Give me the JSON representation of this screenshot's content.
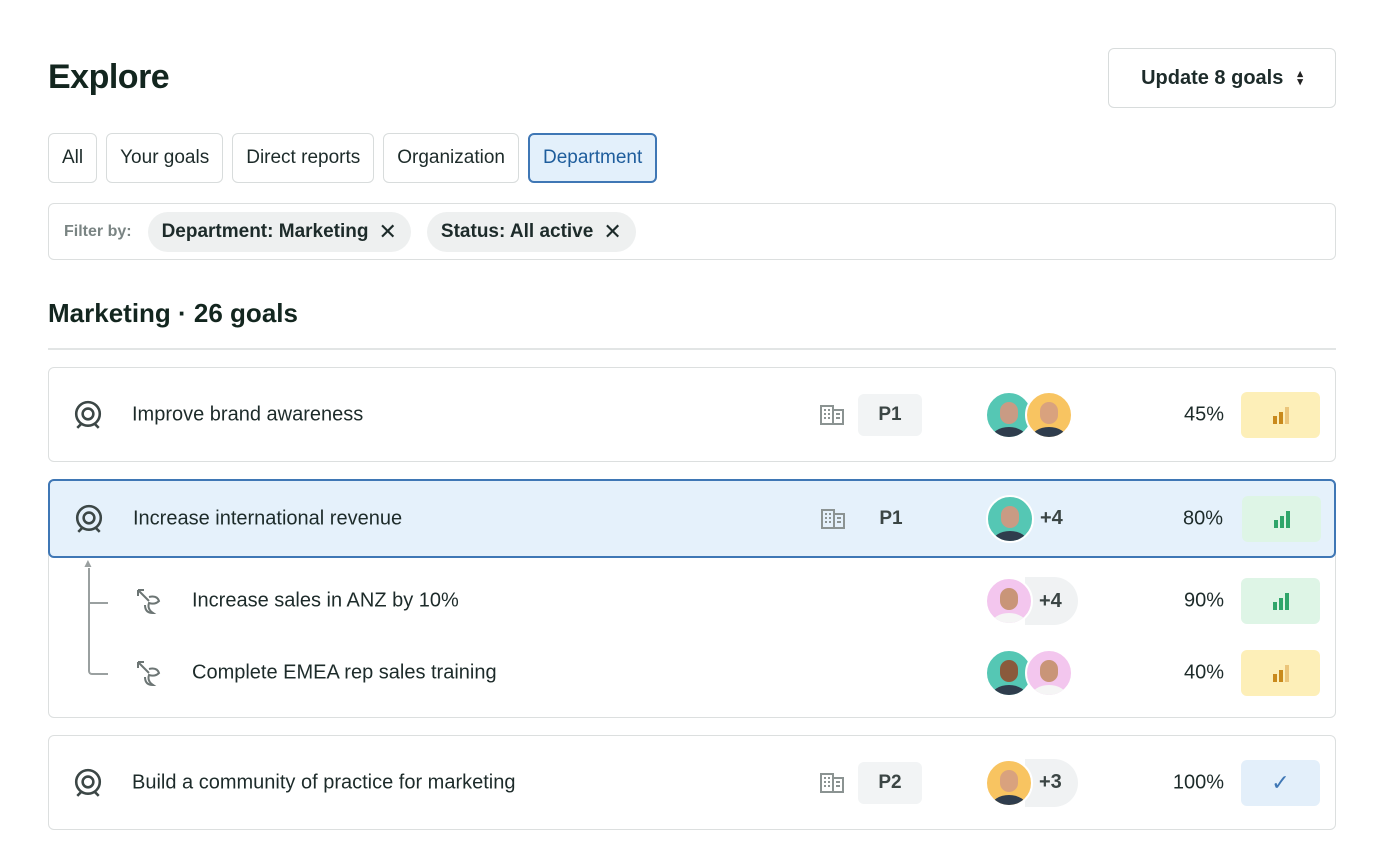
{
  "header": {
    "title": "Explore",
    "update_button": "Update 8 goals"
  },
  "tabs": [
    {
      "label": "All"
    },
    {
      "label": "Your goals"
    },
    {
      "label": "Direct reports"
    },
    {
      "label": "Organization"
    },
    {
      "label": "Department",
      "active": true
    }
  ],
  "filter": {
    "label": "Filter by:",
    "chips": [
      {
        "label": "Department: Marketing"
      },
      {
        "label": "Status: All active"
      }
    ]
  },
  "section": {
    "title": "Marketing · 26 goals"
  },
  "goals": [
    {
      "title": "Improve brand awareness",
      "priority": "P1",
      "more": "",
      "progress": "45%",
      "status": "at-risk"
    },
    {
      "title": "Increase international revenue",
      "priority": "P1",
      "more": "+4",
      "progress": "80%",
      "status": "on-track",
      "subgoals": [
        {
          "title": "Increase sales in ANZ by 10%",
          "more": "+4",
          "progress": "90%",
          "status": "on-track"
        },
        {
          "title": "Complete EMEA rep sales training",
          "more": "",
          "progress": "40%",
          "status": "at-risk"
        }
      ]
    },
    {
      "title": "Build a community of practice for marketing",
      "priority": "P2",
      "more": "+3",
      "progress": "100%",
      "status": "complete"
    }
  ],
  "colors": {
    "accent": "#3f77b5",
    "at_risk_bg": "#fdefb8",
    "at_risk": "#c98a1c",
    "on_track_bg": "#def5e6",
    "on_track": "#2fa56a",
    "complete_bg": "#e3effa",
    "complete": "#3f77b5"
  }
}
